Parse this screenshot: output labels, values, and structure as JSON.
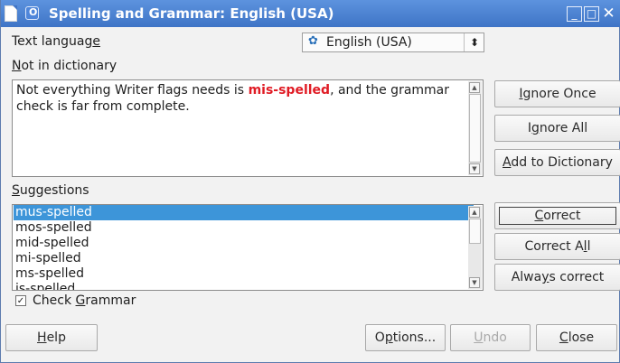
{
  "window": {
    "title": "Spelling and Grammar: English (USA)",
    "minimize_glyph": "_",
    "maximize_glyph": "□",
    "close_glyph": "✕"
  },
  "language": {
    "label_pre": "Text languag",
    "label_key": "e",
    "value": "English (USA)",
    "flag_icon": "✿"
  },
  "dictionary": {
    "label_key": "N",
    "label_post": "ot in dictionary",
    "text_before": "Not everything Writer flags needs is ",
    "misspelled_word": "mis-spelled",
    "text_after": ", and the grammar check is far from complete."
  },
  "suggestions": {
    "label_key": "S",
    "label_post": "uggestions",
    "items": [
      "mus-spelled",
      "mos-spelled",
      "mid-spelled",
      "mi-spelled",
      "ms-spelled",
      "is-spelled"
    ],
    "selected_index": 0
  },
  "grammar": {
    "checked": true,
    "check_glyph": "✓",
    "label_pre": "Check ",
    "label_key": "G",
    "label_post": "rammar"
  },
  "buttons": {
    "ignore_once": {
      "pre": "",
      "key": "I",
      "post": "gnore Once"
    },
    "ignore_all": {
      "pre": "I",
      "key": "g",
      "post": "nore All"
    },
    "add_dictionary": {
      "pre": "",
      "key": "A",
      "post": "dd to Dictionary"
    },
    "correct": {
      "pre": "",
      "key": "C",
      "post": "orrect"
    },
    "correct_all": {
      "pre": "Correct A",
      "key": "l",
      "post": "l"
    },
    "always_correct": {
      "pre": "Alwa",
      "key": "y",
      "post": "s correct"
    },
    "help": {
      "pre": "",
      "key": "H",
      "post": "elp"
    },
    "options": {
      "pre": "O",
      "key": "p",
      "post": "tions..."
    },
    "undo": {
      "pre": "",
      "key": "U",
      "post": "ndo"
    },
    "close": {
      "pre": "",
      "key": "C",
      "post": "lose"
    }
  },
  "colors": {
    "titlebar": "#3f74c6",
    "selection": "#3d95d9",
    "error_text": "#e01b24"
  }
}
